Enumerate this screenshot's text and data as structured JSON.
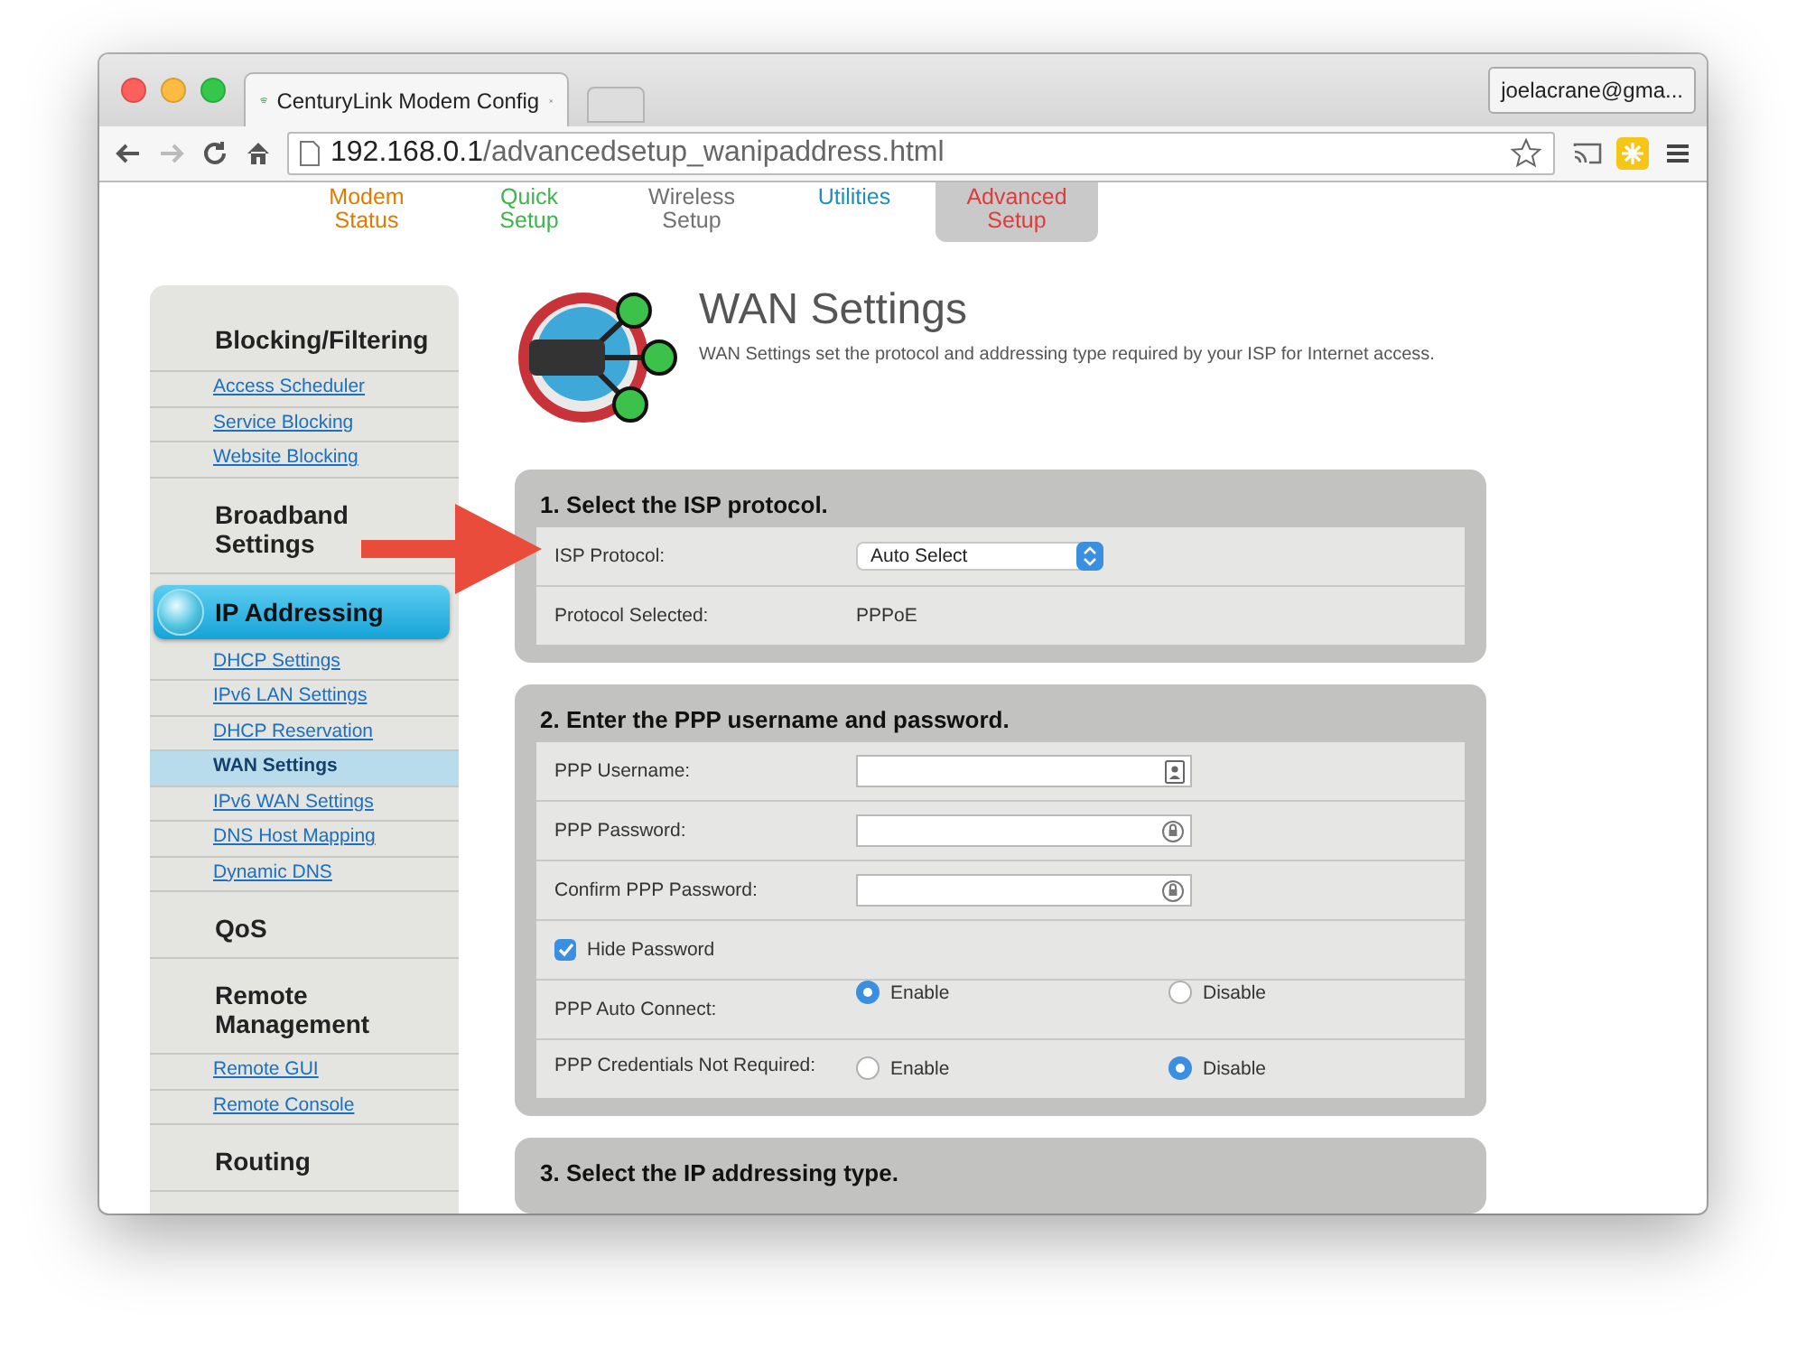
{
  "browser": {
    "tab_title": "CenturyLink Modem Config",
    "account": "joelacrane@gma...",
    "url_host": "192.168.0.1",
    "url_path": "/advancedsetup_wanipaddress.html"
  },
  "top_nav": [
    {
      "label": "Modem Status",
      "color": "#e07b00",
      "selected": false
    },
    {
      "label": "Quick Setup",
      "color": "#3cb54a",
      "selected": false
    },
    {
      "label": "Wireless Setup",
      "color": "#707070",
      "selected": false
    },
    {
      "label": "Utilities",
      "color": "#1a8fc0",
      "selected": false
    },
    {
      "label": "Advanced Setup",
      "color": "#e03a3a",
      "selected": true
    }
  ],
  "sidebar": {
    "groups": [
      {
        "heading": "Blocking/Filtering",
        "active": false,
        "items": [
          {
            "label": "Access Scheduler",
            "selected": false
          },
          {
            "label": "Service Blocking",
            "selected": false
          },
          {
            "label": "Website Blocking",
            "selected": false
          }
        ]
      },
      {
        "heading": "Broadband Settings",
        "active": false
      },
      {
        "heading": "IP Addressing",
        "active": true,
        "items": [
          {
            "label": "DHCP Settings",
            "selected": false
          },
          {
            "label": "IPv6 LAN Settings",
            "selected": false
          },
          {
            "label": "DHCP Reservation",
            "selected": false
          },
          {
            "label": "WAN Settings",
            "selected": true
          },
          {
            "label": "IPv6 WAN Settings",
            "selected": false
          },
          {
            "label": "DNS Host Mapping",
            "selected": false
          },
          {
            "label": "Dynamic DNS",
            "selected": false
          }
        ]
      },
      {
        "heading": "QoS",
        "active": false
      },
      {
        "heading": "Remote Management",
        "active": false,
        "items": [
          {
            "label": "Remote GUI",
            "selected": false
          },
          {
            "label": "Remote Console",
            "selected": false
          }
        ]
      },
      {
        "heading": "Routing",
        "active": false
      }
    ]
  },
  "page": {
    "title": "WAN Settings",
    "description": "WAN Settings set the protocol and addressing type required by your ISP for Internet access."
  },
  "sections": [
    {
      "title": "1. Select the ISP protocol.",
      "rows": [
        {
          "kind": "select",
          "label": "ISP Protocol:",
          "value": "Auto Select"
        },
        {
          "kind": "text",
          "label": "Protocol Selected:",
          "value": "PPPoE"
        }
      ]
    },
    {
      "title": "2. Enter the PPP username and password.",
      "rows": [
        {
          "kind": "text_input",
          "label": "PPP Username:"
        },
        {
          "kind": "password_input",
          "label": "PPP Password:"
        },
        {
          "kind": "password_input",
          "label": "Confirm PPP Password:"
        },
        {
          "kind": "checkbox",
          "label": "Hide Password",
          "checked": true
        },
        {
          "kind": "radio",
          "label": "PPP Auto Connect:",
          "options": [
            {
              "label": "Enable",
              "selected": true
            },
            {
              "label": "Disable",
              "selected": false
            }
          ]
        },
        {
          "kind": "radio",
          "label": "PPP Credentials Not Required:",
          "options": [
            {
              "label": "Enable",
              "selected": false
            },
            {
              "label": "Disable",
              "selected": true
            }
          ]
        }
      ]
    },
    {
      "title": "3. Select the IP addressing type."
    }
  ]
}
